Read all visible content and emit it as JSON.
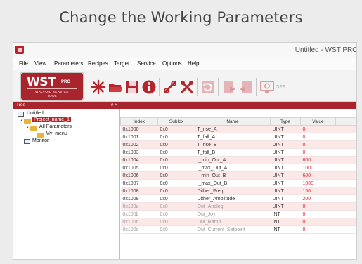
{
  "page": {
    "title": "Change the Working Parameters"
  },
  "window": {
    "title": "Untitled - WST PRO"
  },
  "menu": [
    "File",
    "View",
    "Parameters",
    "Recipes",
    "Target",
    "Service",
    "Options",
    "Help"
  ],
  "logo": {
    "main": "WST",
    "pro": "PRO",
    "sub1": "WALVOIL SERVICE",
    "sub2": "TOOL"
  },
  "toolbar": {
    "icons": [
      "new-icon",
      "open-icon",
      "save-icon",
      "info-icon",
      "connect-icon",
      "tools-icon",
      "refresh-icon",
      "download-icon",
      "upload-icon",
      "monitor-off-icon"
    ],
    "off_label": "OFF"
  },
  "tree": {
    "header": "Tree",
    "header_buttons": "# ×",
    "nodes": {
      "root": "Untitled",
      "project": "Project_name_1",
      "all_params": "All Parameters",
      "my_menu": "My_menu",
      "monitor": "Monitor"
    }
  },
  "table": {
    "columns": [
      "Index",
      "SubIdx",
      "Name",
      "Type",
      "Value"
    ],
    "rows": [
      {
        "index": "0x1000",
        "sub": "0x0",
        "name": "T_rise_A",
        "type": "UINT",
        "value": "0",
        "dim": false
      },
      {
        "index": "0x1001",
        "sub": "0x0",
        "name": "T_fall_A",
        "type": "UINT",
        "value": "0",
        "dim": false
      },
      {
        "index": "0x1002",
        "sub": "0x0",
        "name": "T_rise_B",
        "type": "UINT",
        "value": "0",
        "dim": false
      },
      {
        "index": "0x1003",
        "sub": "0x0",
        "name": "T_fall_B",
        "type": "UINT",
        "value": "0",
        "dim": false
      },
      {
        "index": "0x1004",
        "sub": "0x0",
        "name": "I_min_Out_A",
        "type": "UINT",
        "value": "600",
        "dim": false
      },
      {
        "index": "0x1005",
        "sub": "0x0",
        "name": "I_max_Out_A",
        "type": "UINT",
        "value": "1000",
        "dim": false
      },
      {
        "index": "0x1006",
        "sub": "0x0",
        "name": "I_min_Out_B",
        "type": "UINT",
        "value": "600",
        "dim": false
      },
      {
        "index": "0x1007",
        "sub": "0x0",
        "name": "I_max_Out_B",
        "type": "UINT",
        "value": "1000",
        "dim": false
      },
      {
        "index": "0x1008",
        "sub": "0x0",
        "name": "Dither_Freq",
        "type": "UINT",
        "value": "150",
        "dim": false
      },
      {
        "index": "0x1009",
        "sub": "0x0",
        "name": "Dither_Amplitude",
        "type": "UINT",
        "value": "200",
        "dim": false
      },
      {
        "index": "0x100a",
        "sub": "0x0",
        "name": "Out_Analog",
        "type": "UINT",
        "value": "0",
        "dim": true
      },
      {
        "index": "0x100b",
        "sub": "0x0",
        "name": "Out_Joy",
        "type": "INT",
        "value": "0",
        "dim": true
      },
      {
        "index": "0x100c",
        "sub": "0x0",
        "name": "Out_Ramp",
        "type": "INT",
        "value": "0",
        "dim": true
      },
      {
        "index": "0x100d",
        "sub": "0x0",
        "name": "Out_Current_Setpoint",
        "type": "INT",
        "value": "0",
        "dim": true
      }
    ]
  },
  "colors": {
    "accent": "#a9252d",
    "row_tint": "#fde8e8",
    "value_red": "#e0262e"
  }
}
